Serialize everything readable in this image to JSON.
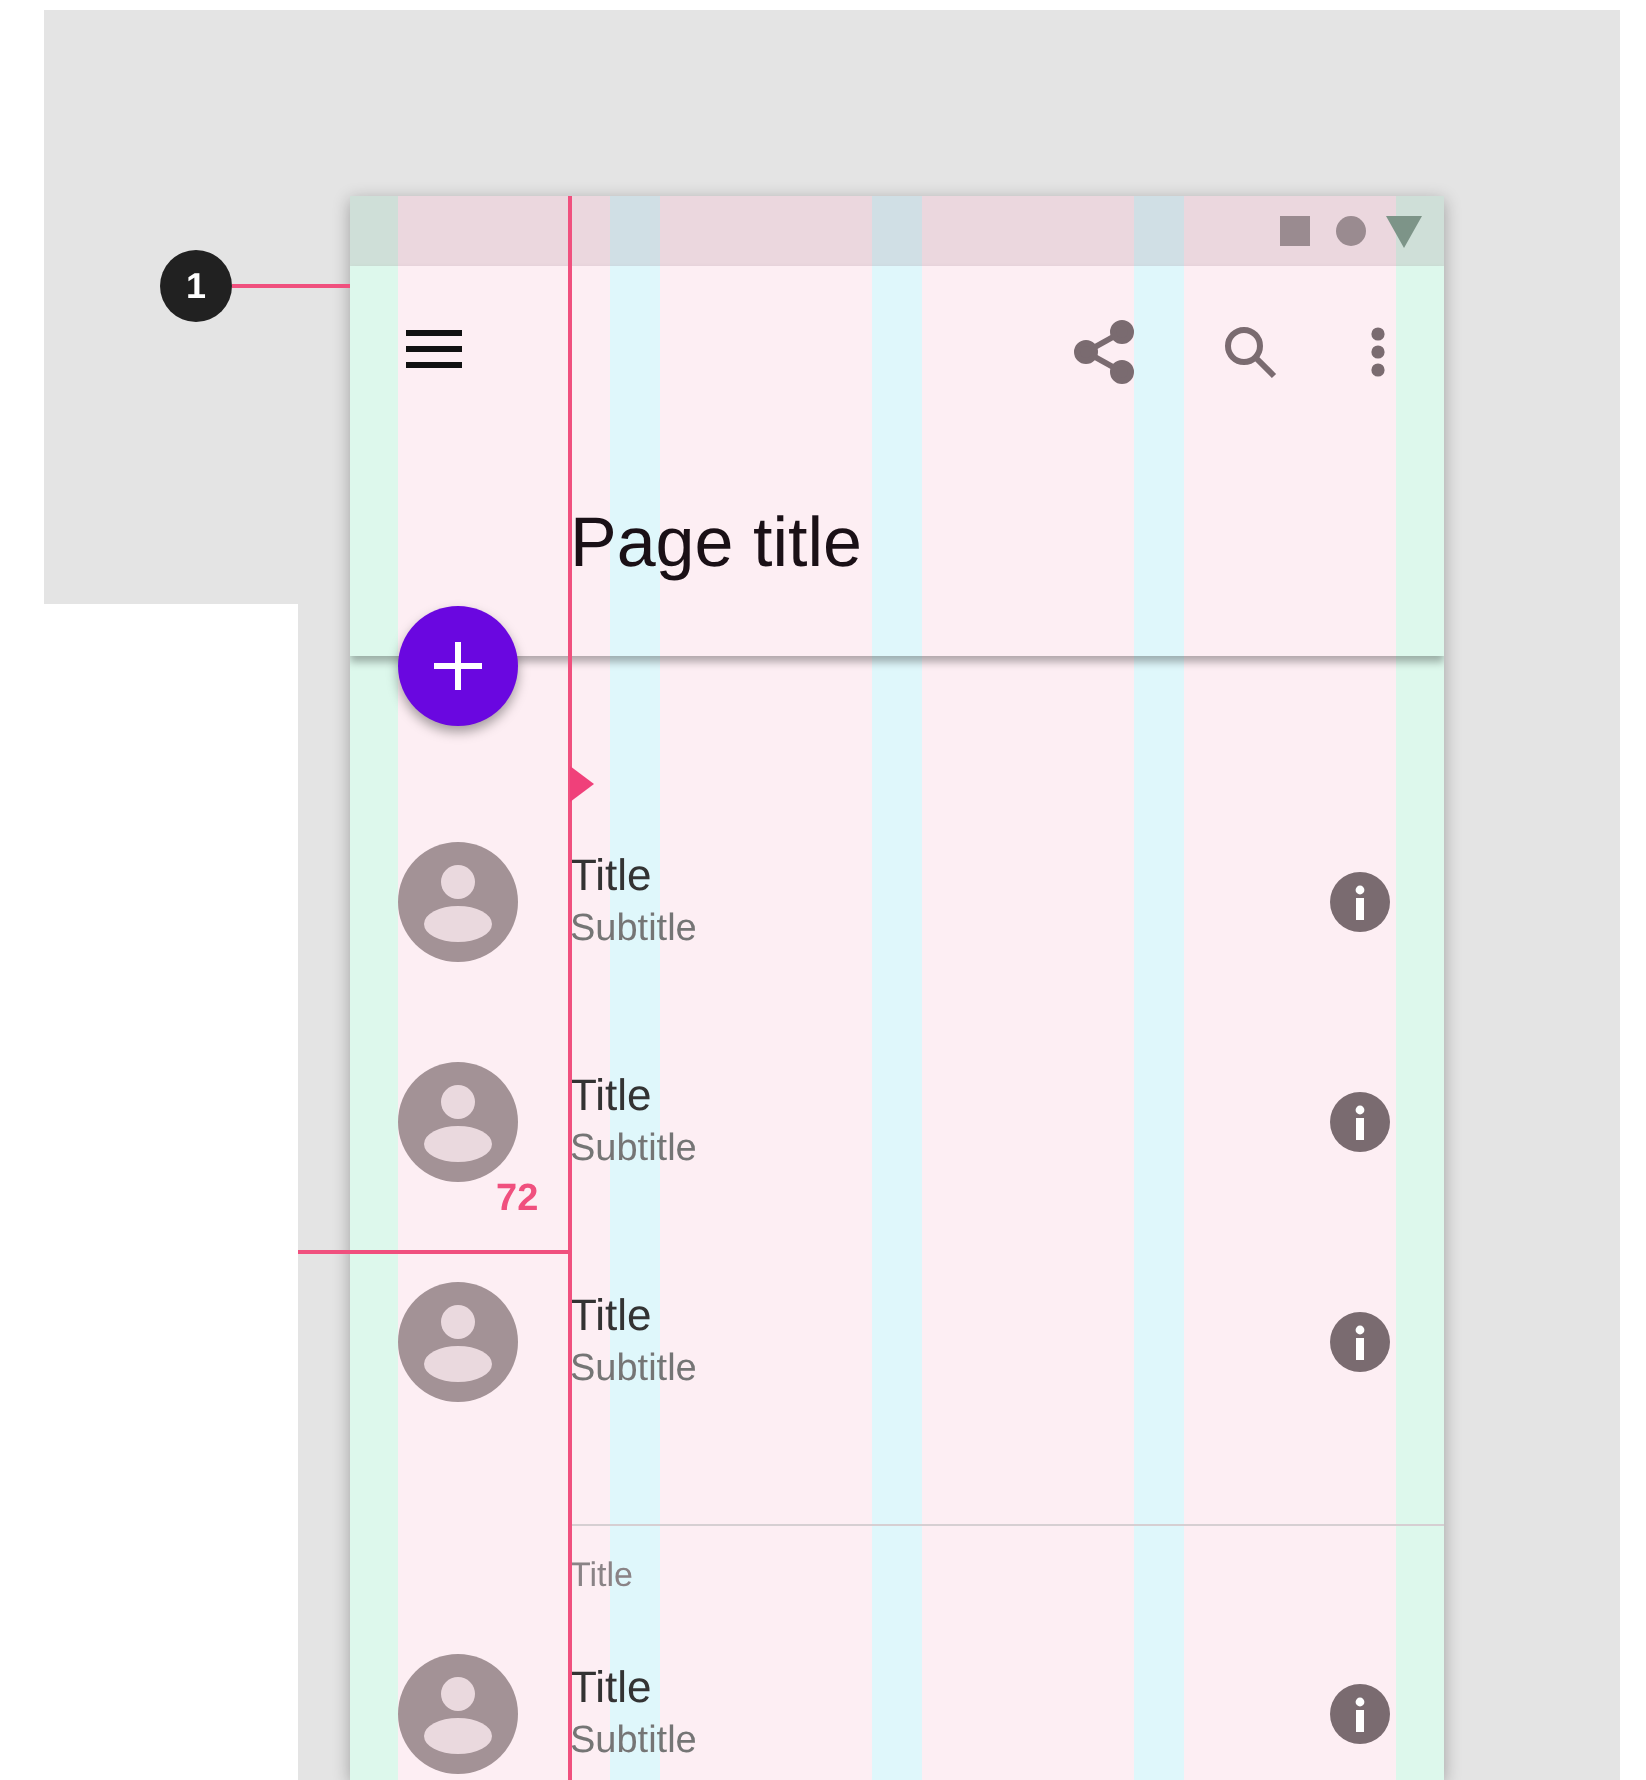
{
  "app_bar": {
    "title": "Page title"
  },
  "list": [
    {
      "kind": "item",
      "title": "Title",
      "subtitle": "Subtitle"
    },
    {
      "kind": "item",
      "title": "Title",
      "subtitle": "Subtitle"
    },
    {
      "kind": "item",
      "title": "Title",
      "subtitle": "Subtitle"
    },
    {
      "kind": "subheader",
      "title": "Title"
    },
    {
      "kind": "item",
      "title": "Title",
      "subtitle": "Subtitle"
    }
  ],
  "annotations": {
    "callout": "1",
    "measure": "72"
  }
}
